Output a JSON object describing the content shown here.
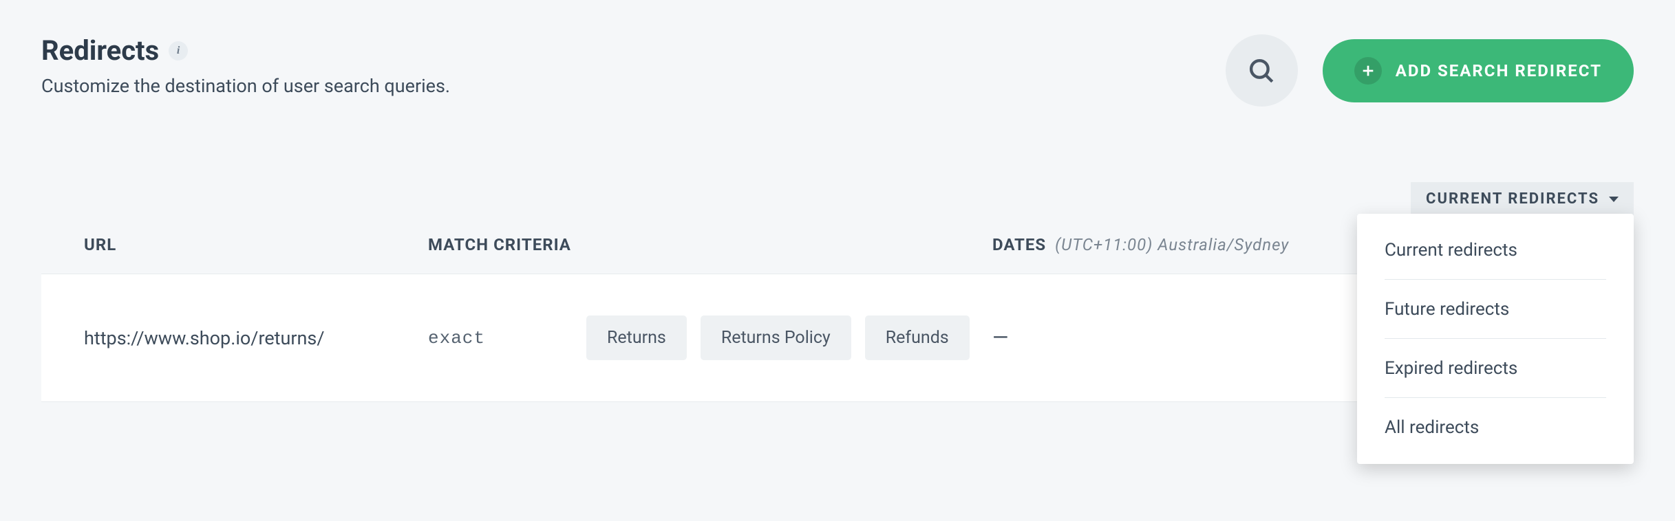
{
  "header": {
    "title": "Redirects",
    "subtitle": "Customize the destination of user search queries.",
    "add_button_label": "ADD SEARCH REDIRECT"
  },
  "filter": {
    "selected_label": "CURRENT REDIRECTS",
    "options": [
      "Current redirects",
      "Future redirects",
      "Expired redirects",
      "All redirects"
    ]
  },
  "table": {
    "columns": {
      "url": "URL",
      "match": "MATCH CRITERIA",
      "dates_label": "DATES",
      "dates_tz": "(UTC+11:00) Australia/Sydney"
    },
    "rows": [
      {
        "url": "https://www.shop.io/returns/",
        "match_type": "exact",
        "criteria": [
          "Returns",
          "Returns Policy",
          "Refunds"
        ],
        "dates": "—"
      }
    ]
  }
}
